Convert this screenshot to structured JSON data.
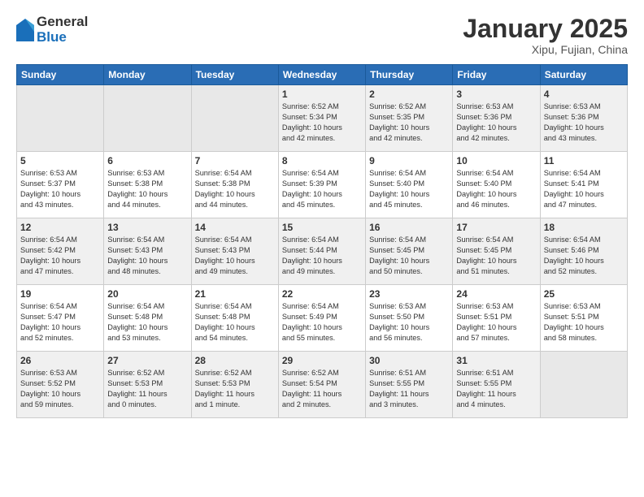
{
  "logo": {
    "general": "General",
    "blue": "Blue"
  },
  "title": "January 2025",
  "location": "Xipu, Fujian, China",
  "weekdays": [
    "Sunday",
    "Monday",
    "Tuesday",
    "Wednesday",
    "Thursday",
    "Friday",
    "Saturday"
  ],
  "weeks": [
    [
      {
        "day": "",
        "info": ""
      },
      {
        "day": "",
        "info": ""
      },
      {
        "day": "",
        "info": ""
      },
      {
        "day": "1",
        "info": "Sunrise: 6:52 AM\nSunset: 5:34 PM\nDaylight: 10 hours\nand 42 minutes."
      },
      {
        "day": "2",
        "info": "Sunrise: 6:52 AM\nSunset: 5:35 PM\nDaylight: 10 hours\nand 42 minutes."
      },
      {
        "day": "3",
        "info": "Sunrise: 6:53 AM\nSunset: 5:36 PM\nDaylight: 10 hours\nand 42 minutes."
      },
      {
        "day": "4",
        "info": "Sunrise: 6:53 AM\nSunset: 5:36 PM\nDaylight: 10 hours\nand 43 minutes."
      }
    ],
    [
      {
        "day": "5",
        "info": "Sunrise: 6:53 AM\nSunset: 5:37 PM\nDaylight: 10 hours\nand 43 minutes."
      },
      {
        "day": "6",
        "info": "Sunrise: 6:53 AM\nSunset: 5:38 PM\nDaylight: 10 hours\nand 44 minutes."
      },
      {
        "day": "7",
        "info": "Sunrise: 6:54 AM\nSunset: 5:38 PM\nDaylight: 10 hours\nand 44 minutes."
      },
      {
        "day": "8",
        "info": "Sunrise: 6:54 AM\nSunset: 5:39 PM\nDaylight: 10 hours\nand 45 minutes."
      },
      {
        "day": "9",
        "info": "Sunrise: 6:54 AM\nSunset: 5:40 PM\nDaylight: 10 hours\nand 45 minutes."
      },
      {
        "day": "10",
        "info": "Sunrise: 6:54 AM\nSunset: 5:40 PM\nDaylight: 10 hours\nand 46 minutes."
      },
      {
        "day": "11",
        "info": "Sunrise: 6:54 AM\nSunset: 5:41 PM\nDaylight: 10 hours\nand 47 minutes."
      }
    ],
    [
      {
        "day": "12",
        "info": "Sunrise: 6:54 AM\nSunset: 5:42 PM\nDaylight: 10 hours\nand 47 minutes."
      },
      {
        "day": "13",
        "info": "Sunrise: 6:54 AM\nSunset: 5:43 PM\nDaylight: 10 hours\nand 48 minutes."
      },
      {
        "day": "14",
        "info": "Sunrise: 6:54 AM\nSunset: 5:43 PM\nDaylight: 10 hours\nand 49 minutes."
      },
      {
        "day": "15",
        "info": "Sunrise: 6:54 AM\nSunset: 5:44 PM\nDaylight: 10 hours\nand 49 minutes."
      },
      {
        "day": "16",
        "info": "Sunrise: 6:54 AM\nSunset: 5:45 PM\nDaylight: 10 hours\nand 50 minutes."
      },
      {
        "day": "17",
        "info": "Sunrise: 6:54 AM\nSunset: 5:45 PM\nDaylight: 10 hours\nand 51 minutes."
      },
      {
        "day": "18",
        "info": "Sunrise: 6:54 AM\nSunset: 5:46 PM\nDaylight: 10 hours\nand 52 minutes."
      }
    ],
    [
      {
        "day": "19",
        "info": "Sunrise: 6:54 AM\nSunset: 5:47 PM\nDaylight: 10 hours\nand 52 minutes."
      },
      {
        "day": "20",
        "info": "Sunrise: 6:54 AM\nSunset: 5:48 PM\nDaylight: 10 hours\nand 53 minutes."
      },
      {
        "day": "21",
        "info": "Sunrise: 6:54 AM\nSunset: 5:48 PM\nDaylight: 10 hours\nand 54 minutes."
      },
      {
        "day": "22",
        "info": "Sunrise: 6:54 AM\nSunset: 5:49 PM\nDaylight: 10 hours\nand 55 minutes."
      },
      {
        "day": "23",
        "info": "Sunrise: 6:53 AM\nSunset: 5:50 PM\nDaylight: 10 hours\nand 56 minutes."
      },
      {
        "day": "24",
        "info": "Sunrise: 6:53 AM\nSunset: 5:51 PM\nDaylight: 10 hours\nand 57 minutes."
      },
      {
        "day": "25",
        "info": "Sunrise: 6:53 AM\nSunset: 5:51 PM\nDaylight: 10 hours\nand 58 minutes."
      }
    ],
    [
      {
        "day": "26",
        "info": "Sunrise: 6:53 AM\nSunset: 5:52 PM\nDaylight: 10 hours\nand 59 minutes."
      },
      {
        "day": "27",
        "info": "Sunrise: 6:52 AM\nSunset: 5:53 PM\nDaylight: 11 hours\nand 0 minutes."
      },
      {
        "day": "28",
        "info": "Sunrise: 6:52 AM\nSunset: 5:53 PM\nDaylight: 11 hours\nand 1 minute."
      },
      {
        "day": "29",
        "info": "Sunrise: 6:52 AM\nSunset: 5:54 PM\nDaylight: 11 hours\nand 2 minutes."
      },
      {
        "day": "30",
        "info": "Sunrise: 6:51 AM\nSunset: 5:55 PM\nDaylight: 11 hours\nand 3 minutes."
      },
      {
        "day": "31",
        "info": "Sunrise: 6:51 AM\nSunset: 5:55 PM\nDaylight: 11 hours\nand 4 minutes."
      },
      {
        "day": "",
        "info": ""
      }
    ]
  ]
}
